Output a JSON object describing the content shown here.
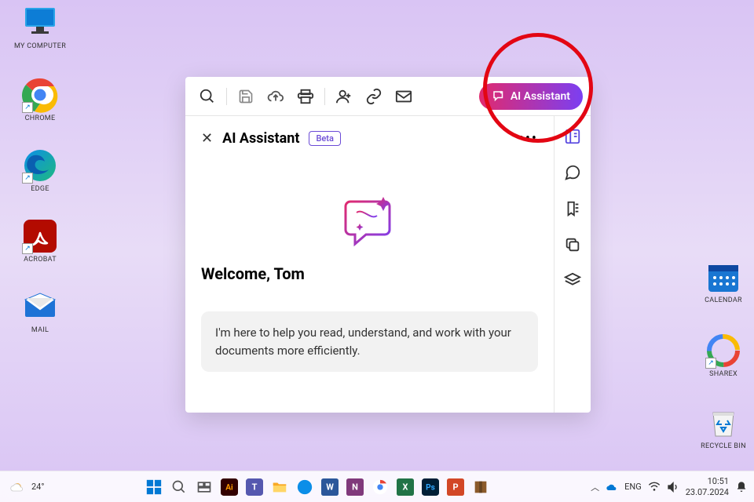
{
  "desktop": {
    "icons": [
      {
        "label": "MY COMPUTER"
      },
      {
        "label": "CHROME"
      },
      {
        "label": "EDGE"
      },
      {
        "label": "ACROBAT"
      },
      {
        "label": "MAIL"
      },
      {
        "label": "CALENDAR"
      },
      {
        "label": "SHAREX"
      },
      {
        "label": "RECYCLE BIN"
      }
    ]
  },
  "app": {
    "toolbar": {
      "ai_button_label": "AI Assistant"
    },
    "panel": {
      "title": "AI Assistant",
      "beta": "Beta",
      "welcome": "Welcome, Tom",
      "intro": "I'm here to help you read, understand, and work with your documents more efficiently."
    }
  },
  "taskbar": {
    "weather": "24°",
    "lang": "ENG",
    "time": "10:51",
    "date": "23.07.2024"
  }
}
